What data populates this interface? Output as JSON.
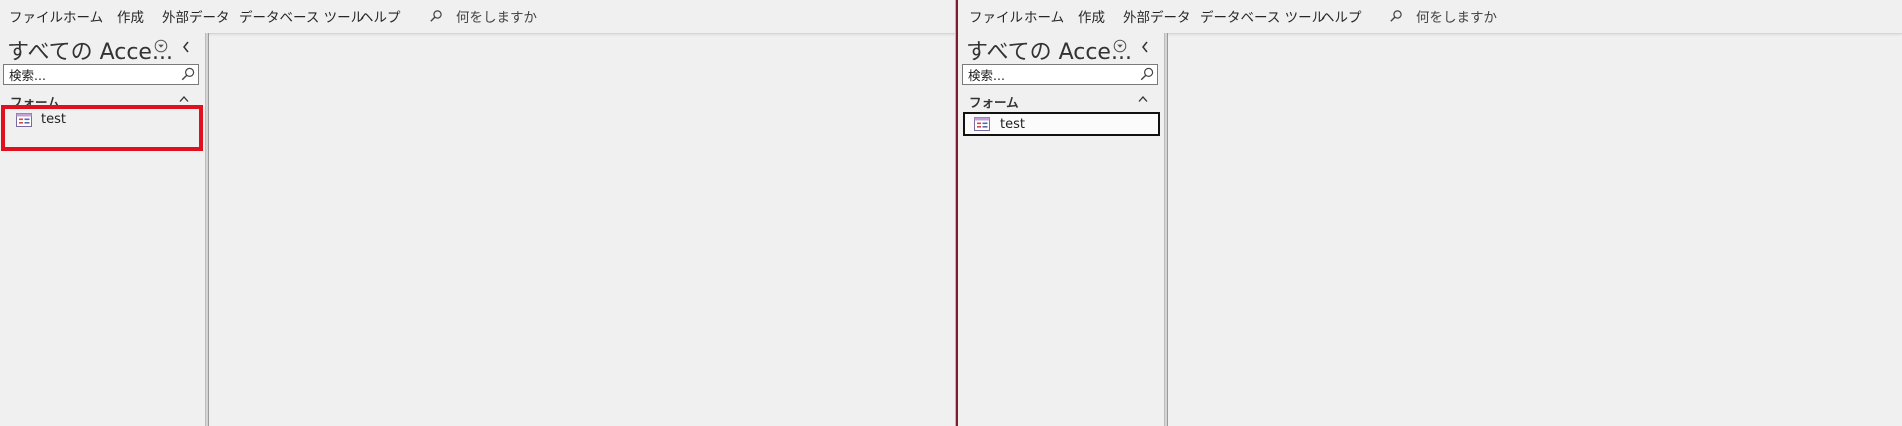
{
  "ribbon": {
    "tabs": [
      "ファイル",
      "ホーム",
      "作成",
      "外部データ",
      "データベース ツール",
      "ヘルプ"
    ],
    "tell_me": "何をしますか"
  },
  "nav": {
    "title": "すべての Acce...",
    "search_placeholder": "検索...",
    "group": "フォーム",
    "items": [
      {
        "label": "test"
      }
    ]
  },
  "colors": {
    "highlight_red": "#e0101e",
    "selection_border": "#111111",
    "window_divider": "#7a1f2a"
  },
  "icons": [
    "search-icon",
    "dropdown-circle-icon",
    "chevron-left-icon",
    "chevron-up-icon",
    "form-icon"
  ]
}
